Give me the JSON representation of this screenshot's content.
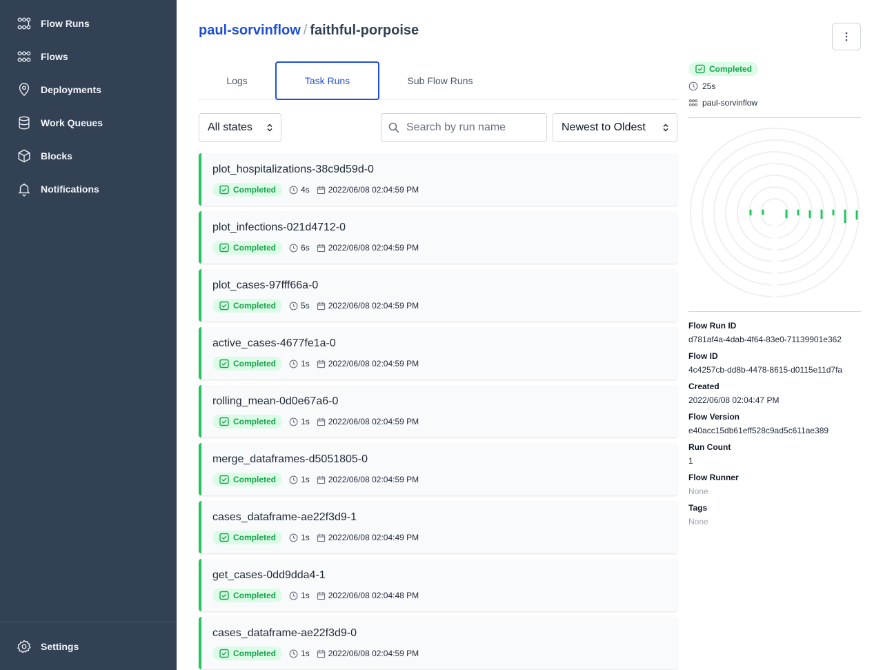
{
  "sidebar": {
    "items": [
      {
        "label": "Flow Runs",
        "icon": "flow-runs-icon"
      },
      {
        "label": "Flows",
        "icon": "flows-icon"
      },
      {
        "label": "Deployments",
        "icon": "map-pin-icon"
      },
      {
        "label": "Work Queues",
        "icon": "database-icon"
      },
      {
        "label": "Blocks",
        "icon": "cube-icon"
      },
      {
        "label": "Notifications",
        "icon": "bell-icon"
      }
    ],
    "settings_label": "Settings"
  },
  "header": {
    "parent": "paul-sorvinflow",
    "separator": "/",
    "current": "faithful-porpoise"
  },
  "tabs": [
    {
      "label": "Logs",
      "active": false
    },
    {
      "label": "Task Runs",
      "active": true
    },
    {
      "label": "Sub Flow Runs",
      "active": false
    }
  ],
  "filters": {
    "state_value": "All states",
    "search_placeholder": "Search by run name",
    "sort_value": "Newest to Oldest"
  },
  "task_runs": [
    {
      "name": "plot_hospitalizations-38c9d59d-0",
      "state": "Completed",
      "duration": "4s",
      "start": "2022/06/08 02:04:59 PM"
    },
    {
      "name": "plot_infections-021d4712-0",
      "state": "Completed",
      "duration": "6s",
      "start": "2022/06/08 02:04:59 PM"
    },
    {
      "name": "plot_cases-97fff66a-0",
      "state": "Completed",
      "duration": "5s",
      "start": "2022/06/08 02:04:59 PM"
    },
    {
      "name": "active_cases-4677fe1a-0",
      "state": "Completed",
      "duration": "1s",
      "start": "2022/06/08 02:04:59 PM"
    },
    {
      "name": "rolling_mean-0d0e67a6-0",
      "state": "Completed",
      "duration": "1s",
      "start": "2022/06/08 02:04:59 PM"
    },
    {
      "name": "merge_dataframes-d5051805-0",
      "state": "Completed",
      "duration": "1s",
      "start": "2022/06/08 02:04:59 PM"
    },
    {
      "name": "cases_dataframe-ae22f3d9-1",
      "state": "Completed",
      "duration": "1s",
      "start": "2022/06/08 02:04:49 PM"
    },
    {
      "name": "get_cases-0dd9dda4-1",
      "state": "Completed",
      "duration": "1s",
      "start": "2022/06/08 02:04:48 PM"
    },
    {
      "name": "cases_dataframe-ae22f3d9-0",
      "state": "Completed",
      "duration": "1s",
      "start": "2022/06/08 02:04:59 PM"
    }
  ],
  "run_summary": {
    "state": "Completed",
    "duration": "25s",
    "flow_name": "paul-sorvinflow"
  },
  "details": [
    {
      "label": "Flow Run ID",
      "value": "d781af4a-4dab-4f64-83e0-71139901e362",
      "muted": false
    },
    {
      "label": "Flow ID",
      "value": "4c4257cb-dd8b-4478-8615-d0115e11d7fa",
      "muted": false
    },
    {
      "label": "Created",
      "value": "2022/06/08 02:04:47 PM",
      "muted": false
    },
    {
      "label": "Flow Version",
      "value": "e40acc15db61eff528c9ad5c611ae389",
      "muted": false
    },
    {
      "label": "Run Count",
      "value": "1",
      "muted": false
    },
    {
      "label": "Flow Runner",
      "value": "None",
      "muted": true
    },
    {
      "label": "Tags",
      "value": "None",
      "muted": true
    }
  ],
  "colors": {
    "sidebar_bg": "#334155",
    "accent": "#1d4ed8",
    "completed": "#22c55e",
    "completed_bg": "#dcfce7"
  }
}
